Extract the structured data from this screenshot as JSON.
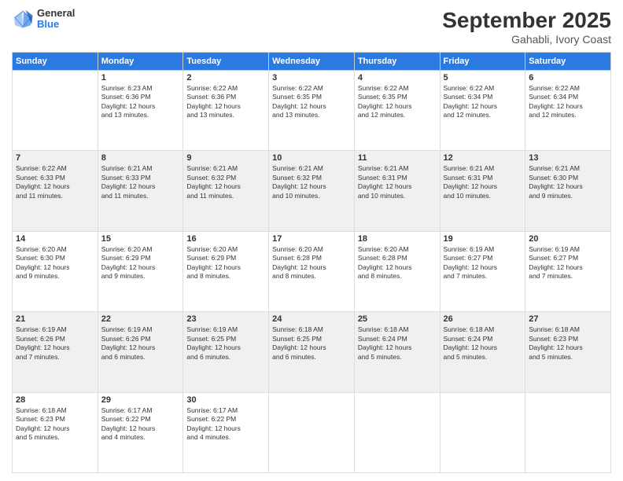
{
  "header": {
    "logo_general": "General",
    "logo_blue": "Blue",
    "month_title": "September 2025",
    "location": "Gahabli, Ivory Coast"
  },
  "days_of_week": [
    "Sunday",
    "Monday",
    "Tuesday",
    "Wednesday",
    "Thursday",
    "Friday",
    "Saturday"
  ],
  "weeks": [
    [
      {
        "day": "",
        "info": ""
      },
      {
        "day": "1",
        "info": "Sunrise: 6:23 AM\nSunset: 6:36 PM\nDaylight: 12 hours\nand 13 minutes."
      },
      {
        "day": "2",
        "info": "Sunrise: 6:22 AM\nSunset: 6:36 PM\nDaylight: 12 hours\nand 13 minutes."
      },
      {
        "day": "3",
        "info": "Sunrise: 6:22 AM\nSunset: 6:35 PM\nDaylight: 12 hours\nand 13 minutes."
      },
      {
        "day": "4",
        "info": "Sunrise: 6:22 AM\nSunset: 6:35 PM\nDaylight: 12 hours\nand 12 minutes."
      },
      {
        "day": "5",
        "info": "Sunrise: 6:22 AM\nSunset: 6:34 PM\nDaylight: 12 hours\nand 12 minutes."
      },
      {
        "day": "6",
        "info": "Sunrise: 6:22 AM\nSunset: 6:34 PM\nDaylight: 12 hours\nand 12 minutes."
      }
    ],
    [
      {
        "day": "7",
        "info": "Sunrise: 6:22 AM\nSunset: 6:33 PM\nDaylight: 12 hours\nand 11 minutes."
      },
      {
        "day": "8",
        "info": "Sunrise: 6:21 AM\nSunset: 6:33 PM\nDaylight: 12 hours\nand 11 minutes."
      },
      {
        "day": "9",
        "info": "Sunrise: 6:21 AM\nSunset: 6:32 PM\nDaylight: 12 hours\nand 11 minutes."
      },
      {
        "day": "10",
        "info": "Sunrise: 6:21 AM\nSunset: 6:32 PM\nDaylight: 12 hours\nand 10 minutes."
      },
      {
        "day": "11",
        "info": "Sunrise: 6:21 AM\nSunset: 6:31 PM\nDaylight: 12 hours\nand 10 minutes."
      },
      {
        "day": "12",
        "info": "Sunrise: 6:21 AM\nSunset: 6:31 PM\nDaylight: 12 hours\nand 10 minutes."
      },
      {
        "day": "13",
        "info": "Sunrise: 6:21 AM\nSunset: 6:30 PM\nDaylight: 12 hours\nand 9 minutes."
      }
    ],
    [
      {
        "day": "14",
        "info": "Sunrise: 6:20 AM\nSunset: 6:30 PM\nDaylight: 12 hours\nand 9 minutes."
      },
      {
        "day": "15",
        "info": "Sunrise: 6:20 AM\nSunset: 6:29 PM\nDaylight: 12 hours\nand 9 minutes."
      },
      {
        "day": "16",
        "info": "Sunrise: 6:20 AM\nSunset: 6:29 PM\nDaylight: 12 hours\nand 8 minutes."
      },
      {
        "day": "17",
        "info": "Sunrise: 6:20 AM\nSunset: 6:28 PM\nDaylight: 12 hours\nand 8 minutes."
      },
      {
        "day": "18",
        "info": "Sunrise: 6:20 AM\nSunset: 6:28 PM\nDaylight: 12 hours\nand 8 minutes."
      },
      {
        "day": "19",
        "info": "Sunrise: 6:19 AM\nSunset: 6:27 PM\nDaylight: 12 hours\nand 7 minutes."
      },
      {
        "day": "20",
        "info": "Sunrise: 6:19 AM\nSunset: 6:27 PM\nDaylight: 12 hours\nand 7 minutes."
      }
    ],
    [
      {
        "day": "21",
        "info": "Sunrise: 6:19 AM\nSunset: 6:26 PM\nDaylight: 12 hours\nand 7 minutes."
      },
      {
        "day": "22",
        "info": "Sunrise: 6:19 AM\nSunset: 6:26 PM\nDaylight: 12 hours\nand 6 minutes."
      },
      {
        "day": "23",
        "info": "Sunrise: 6:19 AM\nSunset: 6:25 PM\nDaylight: 12 hours\nand 6 minutes."
      },
      {
        "day": "24",
        "info": "Sunrise: 6:18 AM\nSunset: 6:25 PM\nDaylight: 12 hours\nand 6 minutes."
      },
      {
        "day": "25",
        "info": "Sunrise: 6:18 AM\nSunset: 6:24 PM\nDaylight: 12 hours\nand 5 minutes."
      },
      {
        "day": "26",
        "info": "Sunrise: 6:18 AM\nSunset: 6:24 PM\nDaylight: 12 hours\nand 5 minutes."
      },
      {
        "day": "27",
        "info": "Sunrise: 6:18 AM\nSunset: 6:23 PM\nDaylight: 12 hours\nand 5 minutes."
      }
    ],
    [
      {
        "day": "28",
        "info": "Sunrise: 6:18 AM\nSunset: 6:23 PM\nDaylight: 12 hours\nand 5 minutes."
      },
      {
        "day": "29",
        "info": "Sunrise: 6:17 AM\nSunset: 6:22 PM\nDaylight: 12 hours\nand 4 minutes."
      },
      {
        "day": "30",
        "info": "Sunrise: 6:17 AM\nSunset: 6:22 PM\nDaylight: 12 hours\nand 4 minutes."
      },
      {
        "day": "",
        "info": ""
      },
      {
        "day": "",
        "info": ""
      },
      {
        "day": "",
        "info": ""
      },
      {
        "day": "",
        "info": ""
      }
    ]
  ]
}
